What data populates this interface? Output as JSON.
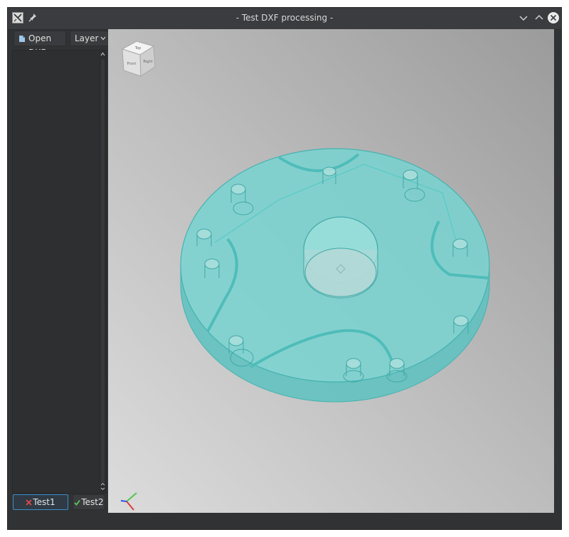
{
  "window": {
    "title": "- Test DXF processing -"
  },
  "toolbar": {
    "open_dxf_label": "Open DXF",
    "layer_label": "Layer"
  },
  "buttons": {
    "test1_label": "Test1",
    "test2_label": "Test2"
  },
  "nav_cube": {
    "top_face": "Top",
    "front_face": "Front",
    "right_face": "Right"
  },
  "icons": {
    "app": "app-icon",
    "pin": "pin-icon",
    "minimize": "chevron-down-icon",
    "maximize": "chevron-up-icon",
    "close": "close-icon",
    "open": "file-icon",
    "cross": "cross-icon",
    "check": "check-icon",
    "axis": "axis-triad-icon"
  },
  "colors": {
    "part_fill": "#6fd3d0",
    "part_edge": "#44b3b0",
    "accent": "#3d8ec9",
    "cross": "#e24848",
    "check": "#5cc95c"
  }
}
